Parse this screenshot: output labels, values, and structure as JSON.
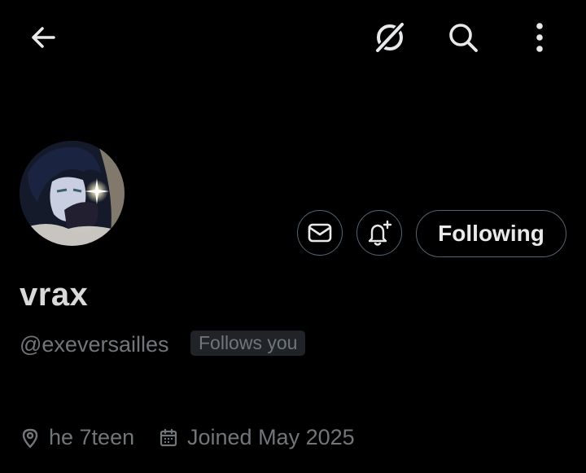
{
  "header": {
    "back_icon": "arrow-left-icon",
    "grok_icon": "grok-icon",
    "search_icon": "search-icon",
    "more_icon": "more-vertical-icon"
  },
  "profile": {
    "display_name": "vrax",
    "handle": "@exeversailles",
    "follows_you_badge": "Follows you",
    "bio_location": "he 7teen",
    "joined": "Joined May 2025"
  },
  "actions": {
    "message_icon": "mail-icon",
    "notify_icon": "bell-plus-icon",
    "follow_label": "Following"
  },
  "colors": {
    "background": "#000000",
    "primary_text": "#e7e9ea",
    "secondary_text": "#71767b",
    "border": "#536471",
    "badge_bg": "#202327"
  }
}
